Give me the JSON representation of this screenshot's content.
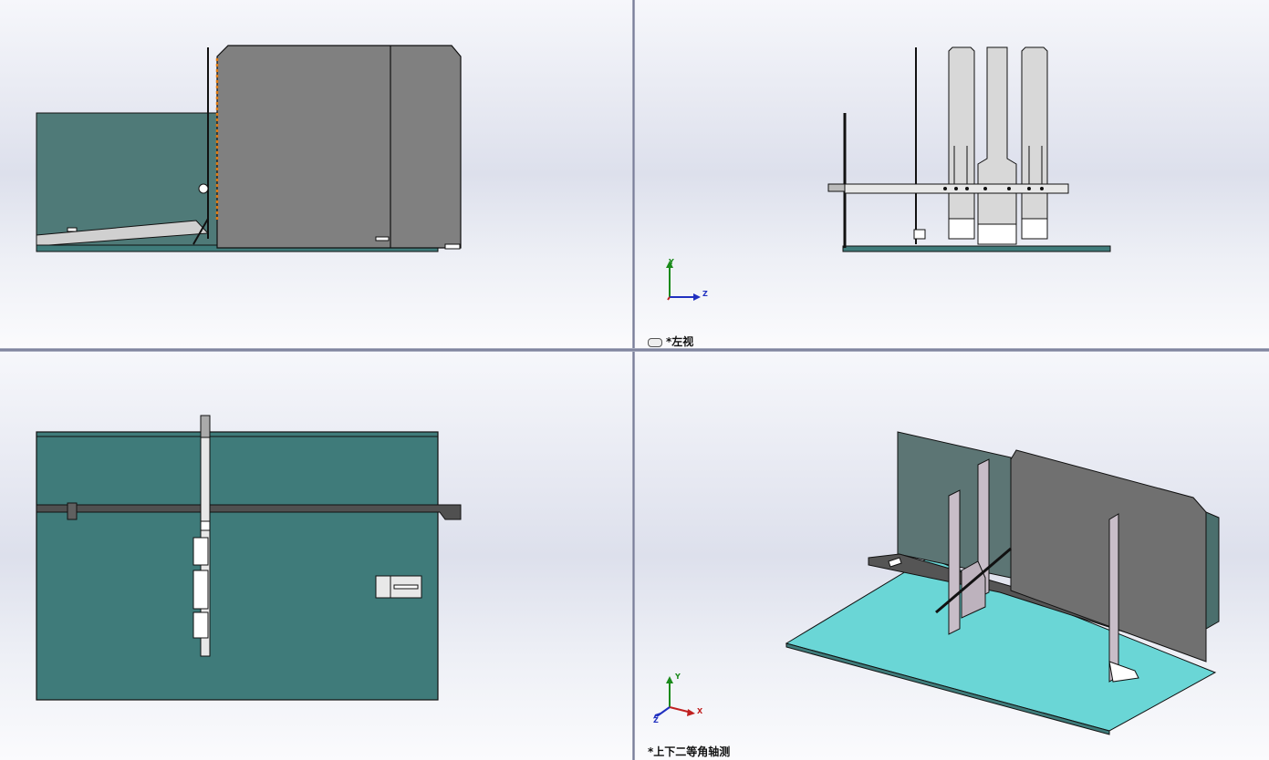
{
  "viewports": {
    "front": {
      "label": ""
    },
    "left": {
      "label": "*左视"
    },
    "top": {
      "label": ""
    },
    "iso": {
      "label": "*上下二等角轴测"
    }
  },
  "triad": {
    "y": "Y",
    "x": "X",
    "z": "Z"
  },
  "colors": {
    "plate_teal": "#3f7b7a",
    "plate_light_teal": "#6ad6d6",
    "panel_gray": "#808080",
    "panel_dark_gray": "#6e6e6e",
    "background_top": "#f6f7fb",
    "background_mid": "#dde0ec",
    "edge": "#111111"
  }
}
